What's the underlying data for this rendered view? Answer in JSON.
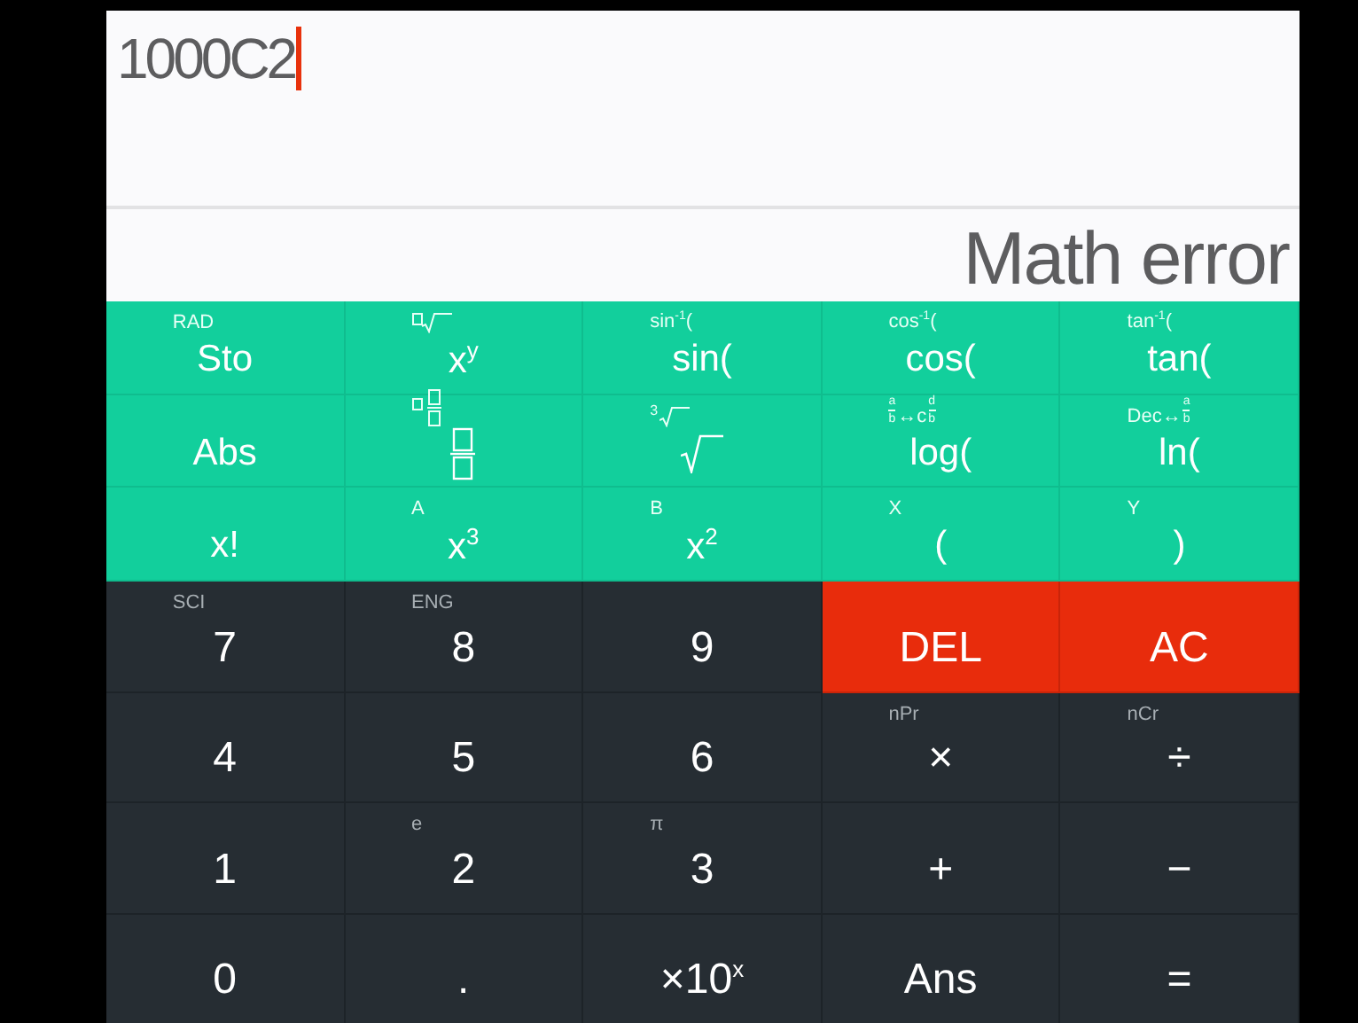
{
  "display": {
    "expression": "1000C2",
    "result": "Math error"
  },
  "keys": [
    {
      "kind": "function",
      "sub": "RAD",
      "main": "Sto"
    },
    {
      "kind": "function",
      "sub_icon": {
        "kind": "nth-root"
      },
      "main": "x$^{y}$"
    },
    {
      "kind": "function",
      "sub": "sin$^{-1}$(",
      "main": "sin("
    },
    {
      "kind": "function",
      "sub": "cos$^{-1}$(",
      "main": "cos("
    },
    {
      "kind": "function",
      "sub": "tan$^{-1}$(",
      "main": "tan("
    },
    {
      "kind": "function",
      "main": "Abs"
    },
    {
      "kind": "function",
      "sub_icon": {
        "kind": "mixed-fraction"
      },
      "main_icon": {
        "kind": "fraction"
      }
    },
    {
      "kind": "function",
      "sub_index": "3",
      "sub_icon": {
        "kind": "root"
      },
      "main_icon": {
        "kind": "sqrt"
      }
    },
    {
      "kind": "function",
      "sub_parts": [
        {
          "num": "a",
          "den": "b"
        },
        {
          "text": "↔c"
        },
        {
          "num": "d",
          "den": "b"
        }
      ],
      "main": "log("
    },
    {
      "kind": "function",
      "sub_parts": [
        {
          "text": "Dec↔"
        },
        {
          "num": "a",
          "den": "b"
        }
      ],
      "main": "ln("
    },
    {
      "kind": "function",
      "main": "x!"
    },
    {
      "kind": "function",
      "sub": "A",
      "main": "x$^{3}$"
    },
    {
      "kind": "function",
      "sub": "B",
      "main": "x$^{2}$"
    },
    {
      "kind": "function",
      "sub": "X",
      "main": "("
    },
    {
      "kind": "function",
      "sub": "Y",
      "main": ")"
    },
    {
      "kind": "digit",
      "sub": "SCI",
      "main": "7"
    },
    {
      "kind": "digit",
      "sub": "ENG",
      "main": "8"
    },
    {
      "kind": "digit",
      "main": "9"
    },
    {
      "kind": "clear",
      "main": "DEL"
    },
    {
      "kind": "clear",
      "main": "AC"
    },
    {
      "kind": "digit",
      "main": "4"
    },
    {
      "kind": "digit",
      "main": "5"
    },
    {
      "kind": "digit",
      "main": "6"
    },
    {
      "kind": "digit",
      "sub": "nPr",
      "main": "×"
    },
    {
      "kind": "digit",
      "sub": "nCr",
      "main": "÷"
    },
    {
      "kind": "digit",
      "main": "1"
    },
    {
      "kind": "digit",
      "sub": "e",
      "main": "2"
    },
    {
      "kind": "digit",
      "sub": "π",
      "main": "3"
    },
    {
      "kind": "digit",
      "main": "+"
    },
    {
      "kind": "digit",
      "main": "−"
    },
    {
      "kind": "digit",
      "main": "0"
    },
    {
      "kind": "digit",
      "main": "."
    },
    {
      "kind": "digit",
      "main": "×10$^{x}$"
    },
    {
      "kind": "digit",
      "main": "Ans"
    },
    {
      "kind": "digit",
      "main": "="
    }
  ]
}
